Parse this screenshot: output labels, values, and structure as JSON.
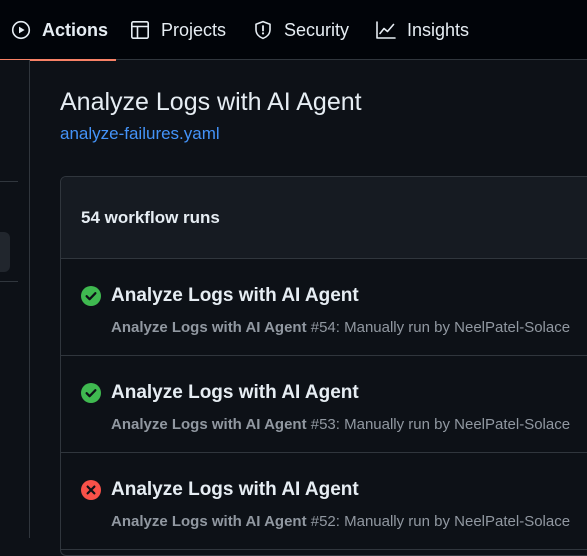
{
  "nav": {
    "tabs": [
      {
        "label": "Actions",
        "icon": "play-circle-icon",
        "active": true
      },
      {
        "label": "Projects",
        "icon": "table-icon",
        "active": false
      },
      {
        "label": "Security",
        "icon": "shield-icon",
        "active": false
      },
      {
        "label": "Insights",
        "icon": "graph-icon",
        "active": false
      }
    ]
  },
  "workflow": {
    "title": "Analyze Logs with AI Agent",
    "file": "analyze-failures.yaml"
  },
  "runs": {
    "count_label": "54 workflow runs",
    "items": [
      {
        "status": "success",
        "status_icon": "check-circle-icon",
        "title": "Analyze Logs with AI Agent",
        "workflow_name": "Analyze Logs with AI Agent",
        "detail": " #54: Manually run by NeelPatel-Solace"
      },
      {
        "status": "success",
        "status_icon": "check-circle-icon",
        "title": "Analyze Logs with AI Agent",
        "workflow_name": "Analyze Logs with AI Agent",
        "detail": " #53: Manually run by NeelPatel-Solace"
      },
      {
        "status": "failure",
        "status_icon": "x-circle-icon",
        "title": "Analyze Logs with AI Agent",
        "workflow_name": "Analyze Logs with AI Agent",
        "detail": " #52: Manually run by NeelPatel-Solace"
      }
    ]
  },
  "colors": {
    "background": "#0d1117",
    "nav_background": "#010409",
    "border": "#30363d",
    "active_underline": "#f78166",
    "link": "#4493f8",
    "success": "#3fb950",
    "failure": "#f85149",
    "muted_text": "#9198a1"
  }
}
